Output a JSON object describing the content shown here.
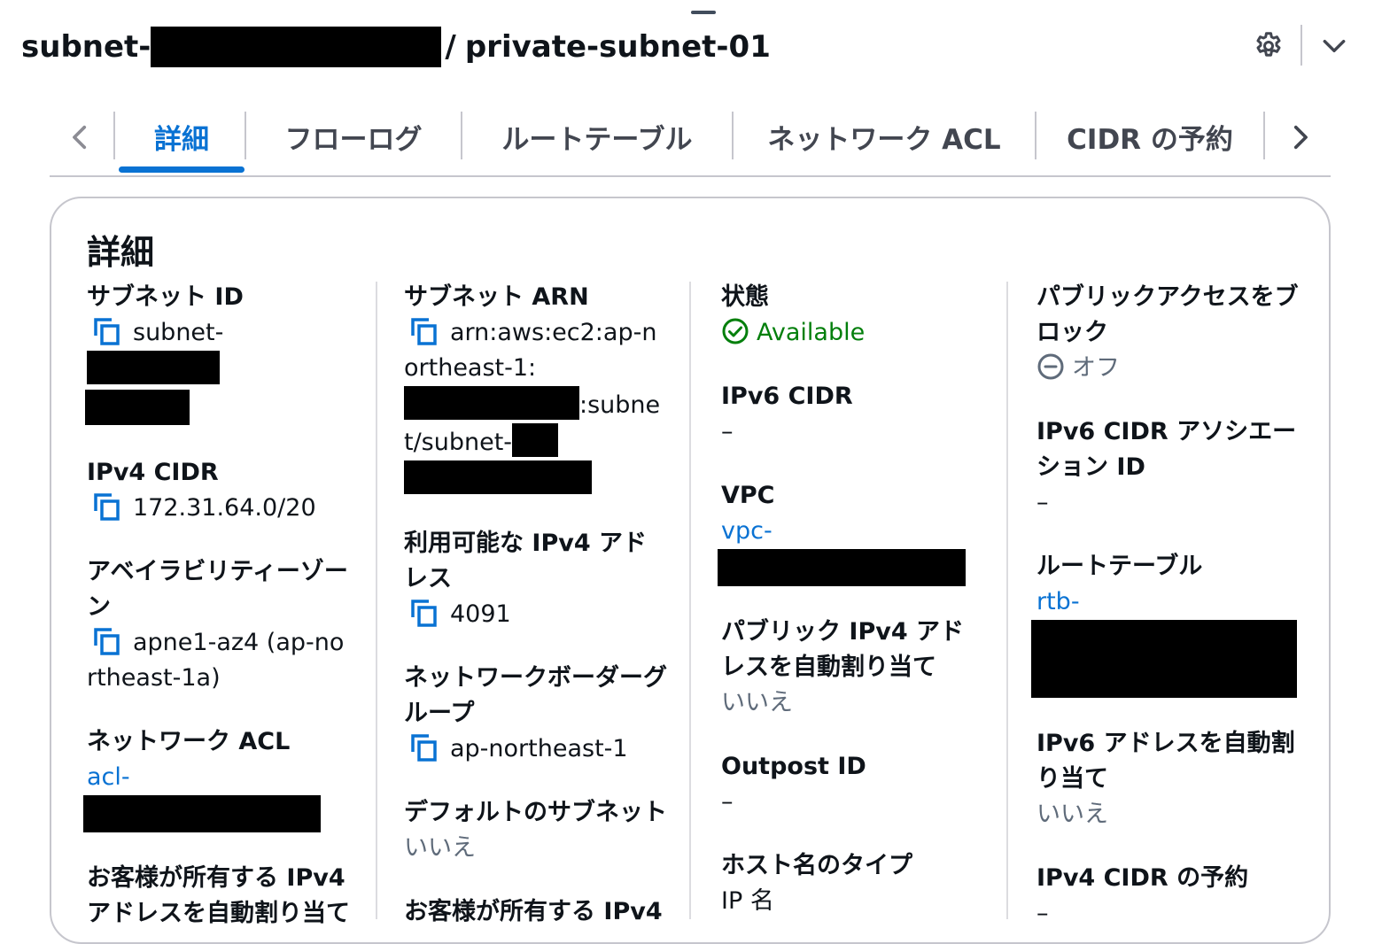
{
  "header": {
    "subnet_prefix": "subnet-",
    "title_separator": "/",
    "subnet_name": "private-subnet-01"
  },
  "icons": {
    "settings": "gear-icon",
    "collapse": "chevron-down-icon",
    "tab_prev": "chevron-left-icon",
    "tab_next": "chevron-right-icon",
    "copy": "copy-icon",
    "status_available": "check-circle-icon",
    "status_off": "minus-circle-icon"
  },
  "colors": {
    "link": "#0972d3",
    "active_tab": "#0972d3",
    "success": "#037f0c",
    "muted": "#5f6b7a"
  },
  "tabs": [
    {
      "label": "詳細",
      "active": true
    },
    {
      "label": "フローログ",
      "active": false
    },
    {
      "label": "ルートテーブル",
      "active": false
    },
    {
      "label": "ネットワーク ACL",
      "active": false
    },
    {
      "label": "CIDR の予約",
      "active": false
    }
  ],
  "details": {
    "heading": "詳細",
    "col1": {
      "subnet_id": {
        "label": "サブネット ID",
        "value": "subnet-"
      },
      "ipv4_cidr": {
        "label": "IPv4 CIDR",
        "value": "172.31.64.0/20"
      },
      "availability_zone": {
        "label": "アベイラビリティーゾーン",
        "value": "apne1-az4 (ap-northeast-1a)"
      },
      "network_acl": {
        "label": "ネットワーク ACL",
        "value": "acl-"
      },
      "customer_owned_ipv4": {
        "label": "お客様が所有する IPv4 アドレスを自動割り当て"
      }
    },
    "col2": {
      "subnet_arn": {
        "label": "サブネット ARN",
        "value_part1": "arn:aws:ec2:ap-northeast-1:",
        "value_part2": ":subnet/subnet-"
      },
      "available_ipv4": {
        "label": "利用可能な IPv4 アドレス",
        "value": "4091"
      },
      "network_border_group": {
        "label": "ネットワークボーダーグループ",
        "value": "ap-northeast-1"
      },
      "default_subnet": {
        "label": "デフォルトのサブネット",
        "value": "いいえ"
      },
      "customer_owned_ipv4_pool": {
        "label": "お客様が所有する IPv4"
      }
    },
    "col3": {
      "state": {
        "label": "状態",
        "value": "Available"
      },
      "ipv6_cidr": {
        "label": "IPv6 CIDR",
        "value": "–"
      },
      "vpc": {
        "label": "VPC",
        "value": "vpc-"
      },
      "auto_assign_public_ipv4": {
        "label": "パブリック IPv4 アドレスを自動割り当て",
        "value": "いいえ"
      },
      "outpost_id": {
        "label": "Outpost ID",
        "value": "–"
      },
      "hostname_type": {
        "label": "ホスト名のタイプ",
        "value": "IP 名"
      }
    },
    "col4": {
      "block_public_access": {
        "label": "パブリックアクセスをブロック",
        "value": "オフ"
      },
      "ipv6_cidr_association_id": {
        "label": "IPv6 CIDR アソシエーション ID",
        "value": "–"
      },
      "route_table": {
        "label": "ルートテーブル",
        "value": "rtb-"
      },
      "auto_assign_ipv6": {
        "label": "IPv6 アドレスを自動割り当て",
        "value": "いいえ"
      },
      "ipv4_cidr_reservations": {
        "label": "IPv4 CIDR の予約",
        "value": "–"
      }
    }
  }
}
